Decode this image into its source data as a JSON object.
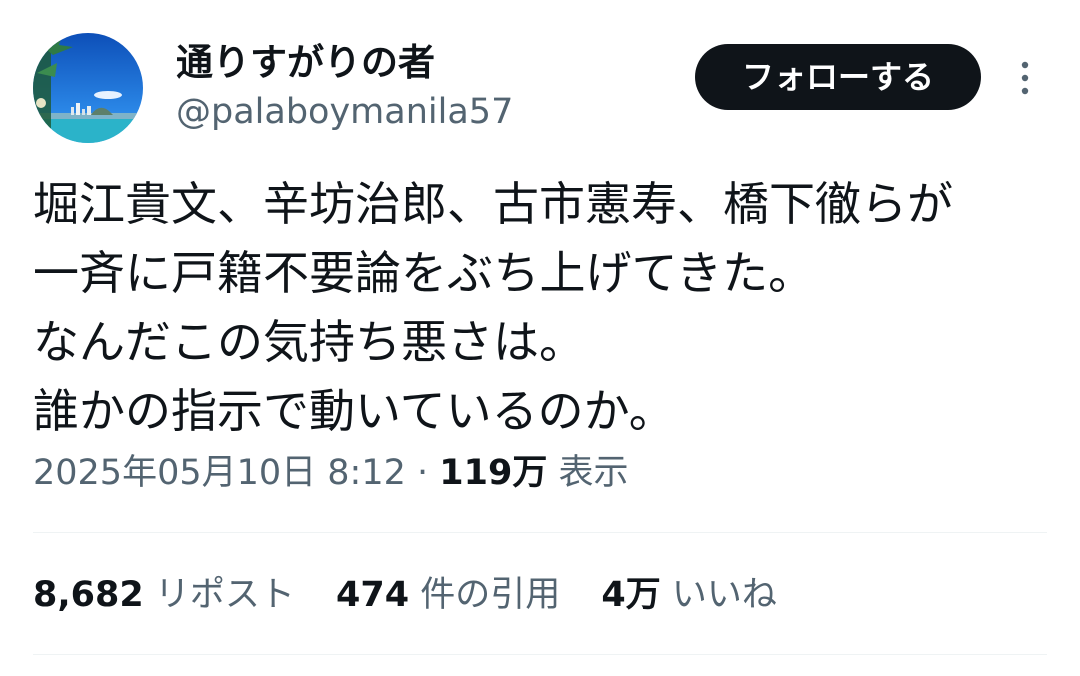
{
  "author": {
    "display_name": "通りすがりの者",
    "handle": "@palaboymanila57",
    "avatar_icon": "beach-skyline-avatar"
  },
  "actions": {
    "follow_label": "フォローする",
    "more_icon": "more-vertical-icon"
  },
  "tweet": {
    "lines": [
      "堀江貴文、辛坊治郎、古市憲寿、橋下徹らが",
      "一斉に戸籍不要論をぶち上げてきた。",
      "なんだこの気持ち悪さは。",
      "誰かの指示で動いているのか。"
    ]
  },
  "meta": {
    "timestamp": "2025年05月10日 8:12",
    "separator": " · ",
    "views_count": "119万",
    "views_label": "表示"
  },
  "stats": {
    "reposts_count": "8,682",
    "reposts_label": "リポスト",
    "quotes_count": "474",
    "quotes_label": "件の引用",
    "likes_count": "4万",
    "likes_label": "いいね"
  },
  "colors": {
    "text_primary": "#0f1419",
    "text_secondary": "#536471",
    "button_bg": "#0f1419",
    "button_text": "#ffffff",
    "divider": "#eff3f4",
    "avatar_sky": "#1d6fd6",
    "avatar_sea": "#2bb3c9"
  }
}
